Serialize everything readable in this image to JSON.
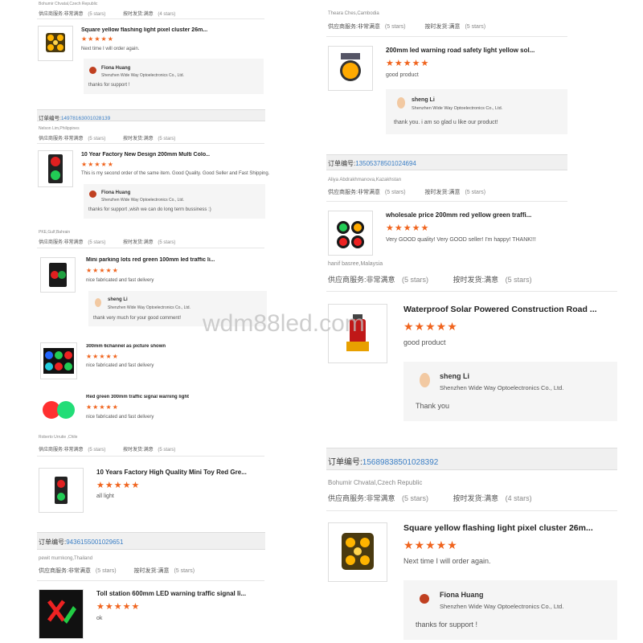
{
  "colors": {
    "star": "#f0641e",
    "order_number": "#3a7ec5",
    "reply_bg": "#f5f5f5"
  },
  "common": {
    "service_label": "供应商服务:",
    "service_value": "非常满意",
    "shipping_label": "按时发货:",
    "shipping_value": "满意",
    "five_stars": "(5 stars)",
    "four_stars": "(4 stars)",
    "order_label": "订单编号:",
    "star_glyphs": "★★★★★",
    "company": "Shenzhen Wide Way Optoelectronics Co., Ltd."
  },
  "left": {
    "buyer1": "Bohumir Chvatal,Czech Republic",
    "item1": {
      "title": "Square yellow flashing light pixel cluster 26m...",
      "comment": "Next time I will order again.",
      "replier": "Fiona Huang",
      "reply": "thanks for support !"
    },
    "order2": "14978163001028139",
    "buyer2": "Nelson Lim,Philippines",
    "item2": {
      "title": "10 Year Factory New Design 200mm Multi Colo...",
      "comment": "This is my second order of the same item. Good Quality. Good Seller and Fast Shipping.",
      "replier": "Fiona Huang",
      "reply": "thanks for support ,wish  we can do long term bussiness :)"
    },
    "buyer3": "PKE,Gulf,Bahrain",
    "item3": {
      "title": "Mini parking lots red green 100mm led traffic li...",
      "comment": "nice fabricated and fast delivery",
      "replier": "sheng Li",
      "reply": "thank very much for your good comment!"
    },
    "item4": {
      "title": "300mm 6channel as picture shown",
      "comment": "nice fabricated and fast delivery"
    },
    "item5": {
      "title": "Red green 300mm traffic signal warning light",
      "comment": "nice fabricated and fast delivery"
    },
    "buyer4": "Roberto Urrutie ,Chile",
    "item6": {
      "title": "10 Years Factory High Quality Mini Toy Red Gre...",
      "comment": "all light"
    },
    "order3": "9436155001029651",
    "buyer5": "pewit murnkong,Thailand",
    "item7": {
      "title": "Toll station 600mm LED warning traffic signal li...",
      "comment": "ok"
    }
  },
  "right": {
    "buyer1": "Theara Ches,Cambodia",
    "item1": {
      "title": "200mm led warning road safety light yellow sol...",
      "comment": "good product",
      "replier": "sheng Li",
      "reply": "thank you. i am so glad u like our product!"
    },
    "order1": "13505378501024694",
    "buyer2": "Aliya Abdrakhmanova,Kazakhstan",
    "item2": {
      "title": "wholesale price 200mm red yellow green traffi...",
      "comment": "Very GOOD quality!  Very GOOD seller!  I'm happy!  THANK!!!"
    },
    "buyer3": "hanif basree,Malaysia",
    "item3": {
      "title": "Waterproof Solar Powered Construction Road ...",
      "comment": "good product",
      "replier": "sheng Li",
      "reply": "Thank you"
    },
    "order2": "15689838501028392",
    "buyer4": "Bohumir Chvatal,Czech Republic",
    "item4": {
      "title": "Square yellow flashing light pixel cluster 26m...",
      "comment": "Next time I will order again.",
      "replier": "Fiona Huang",
      "reply": "thanks for support !"
    }
  },
  "watermark": "wdm88led.com"
}
